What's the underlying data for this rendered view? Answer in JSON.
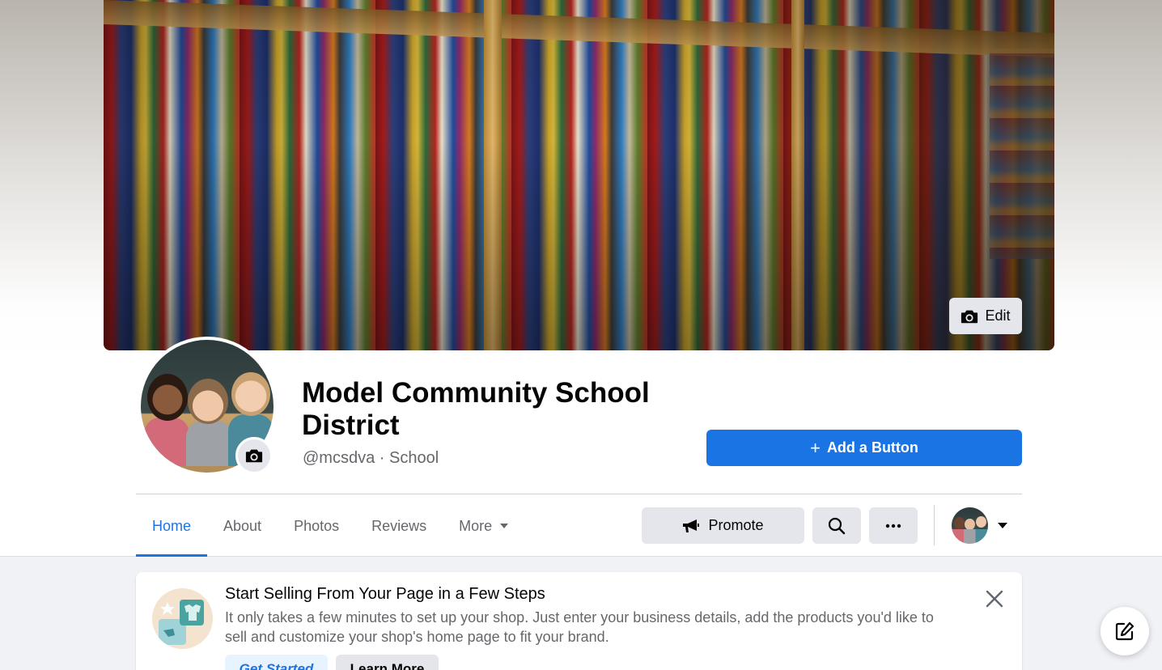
{
  "cover": {
    "edit_label": "Edit"
  },
  "profile": {
    "name": "Model Community School District",
    "handle": "@mcsdva · School"
  },
  "actions": {
    "add_button_label": "Add a Button",
    "promote_label": "Promote"
  },
  "tabs": [
    {
      "label": "Home",
      "active": true
    },
    {
      "label": "About",
      "active": false
    },
    {
      "label": "Photos",
      "active": false
    },
    {
      "label": "Reviews",
      "active": false
    },
    {
      "label": "More",
      "active": false
    }
  ],
  "shop_card": {
    "title": "Start Selling From Your Page in a Few Steps",
    "description": "It only takes a few minutes to set up your shop. Just enter your business details, add the products you'd like to sell and customize your shop's home page to fit your brand.",
    "primary_label": "Get Started",
    "secondary_label": "Learn More"
  },
  "colors": {
    "accent": "#1b74e4",
    "surface": "#e4e6eb",
    "background": "#f0f2f5"
  },
  "icons": [
    "camera-icon",
    "plus-icon",
    "megaphone-icon",
    "search-icon",
    "ellipsis-icon",
    "chevron-down-icon",
    "close-icon",
    "compose-icon",
    "shop-icon"
  ]
}
